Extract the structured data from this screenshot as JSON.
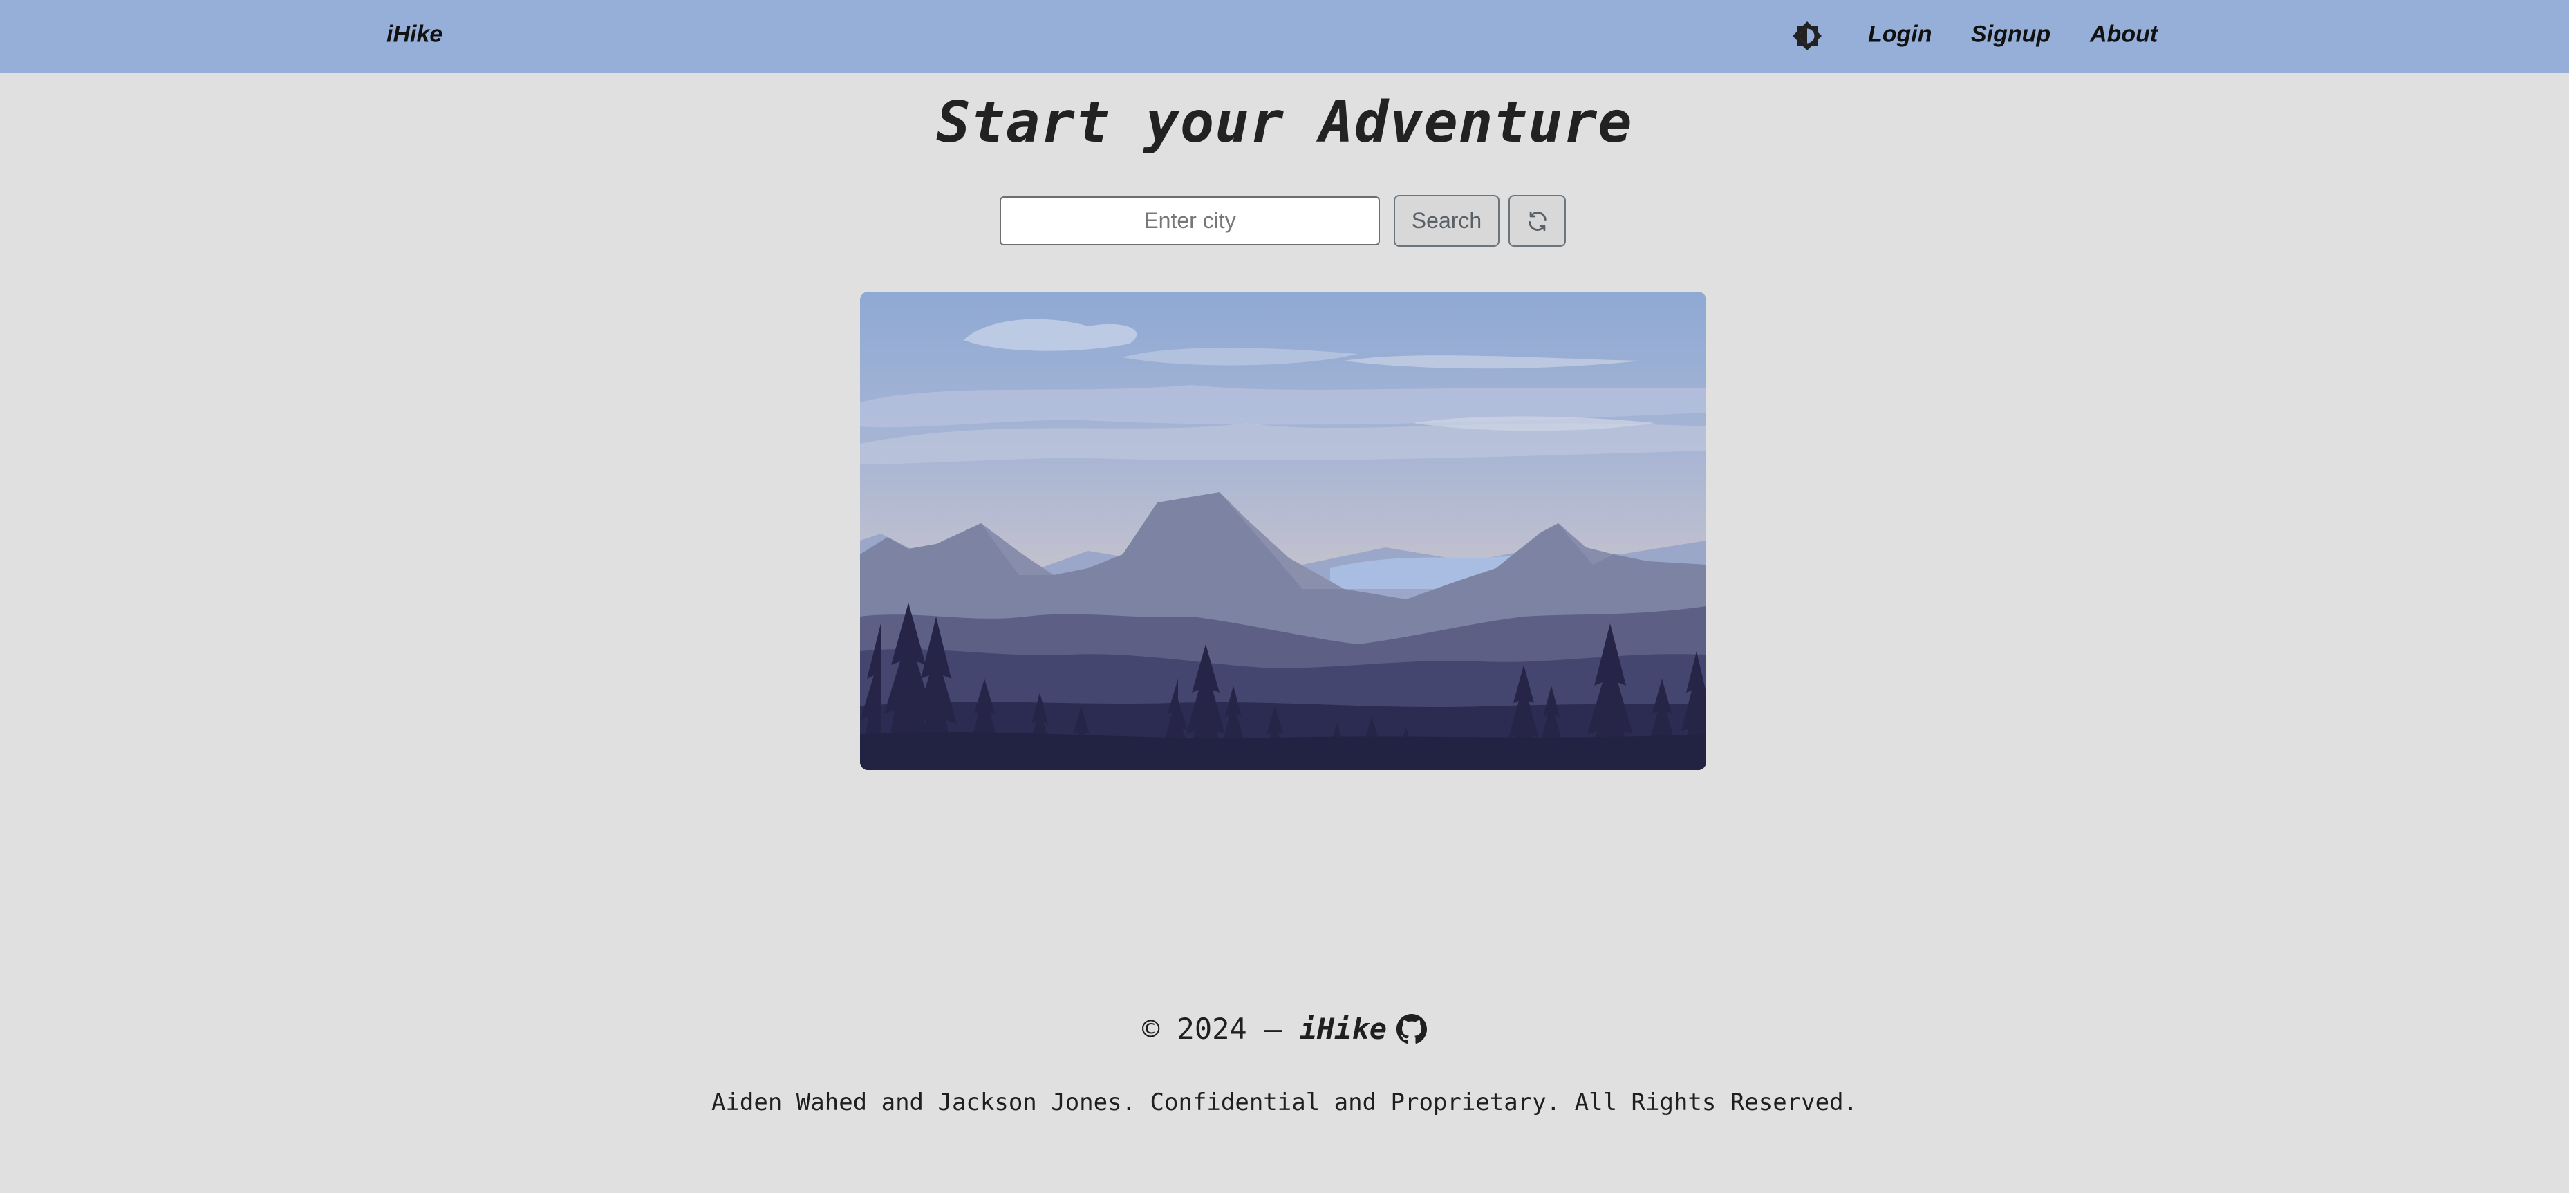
{
  "navbar": {
    "brand": "iHike",
    "theme_toggle_icon": "half-circle-sun-icon",
    "links": {
      "login": "Login",
      "signup": "Signup",
      "about": "About"
    },
    "background": "#96afd8"
  },
  "main": {
    "headline": "Start your Adventure",
    "search": {
      "placeholder": "Enter city",
      "value": "",
      "search_label": "Search",
      "refresh_icon": "refresh-icon"
    },
    "hero_image": "mountain-landscape-illustration"
  },
  "footer": {
    "copyright_prefix": "© 2024 – ",
    "brand": "iHike",
    "github_icon": "github-icon",
    "notice": "Aiden Wahed and Jackson Jones. Confidential and Proprietary. All Rights Reserved."
  },
  "colors": {
    "page_background": "#e0e0e0",
    "navbar": "#96afd8",
    "text": "#1f1f1f"
  }
}
